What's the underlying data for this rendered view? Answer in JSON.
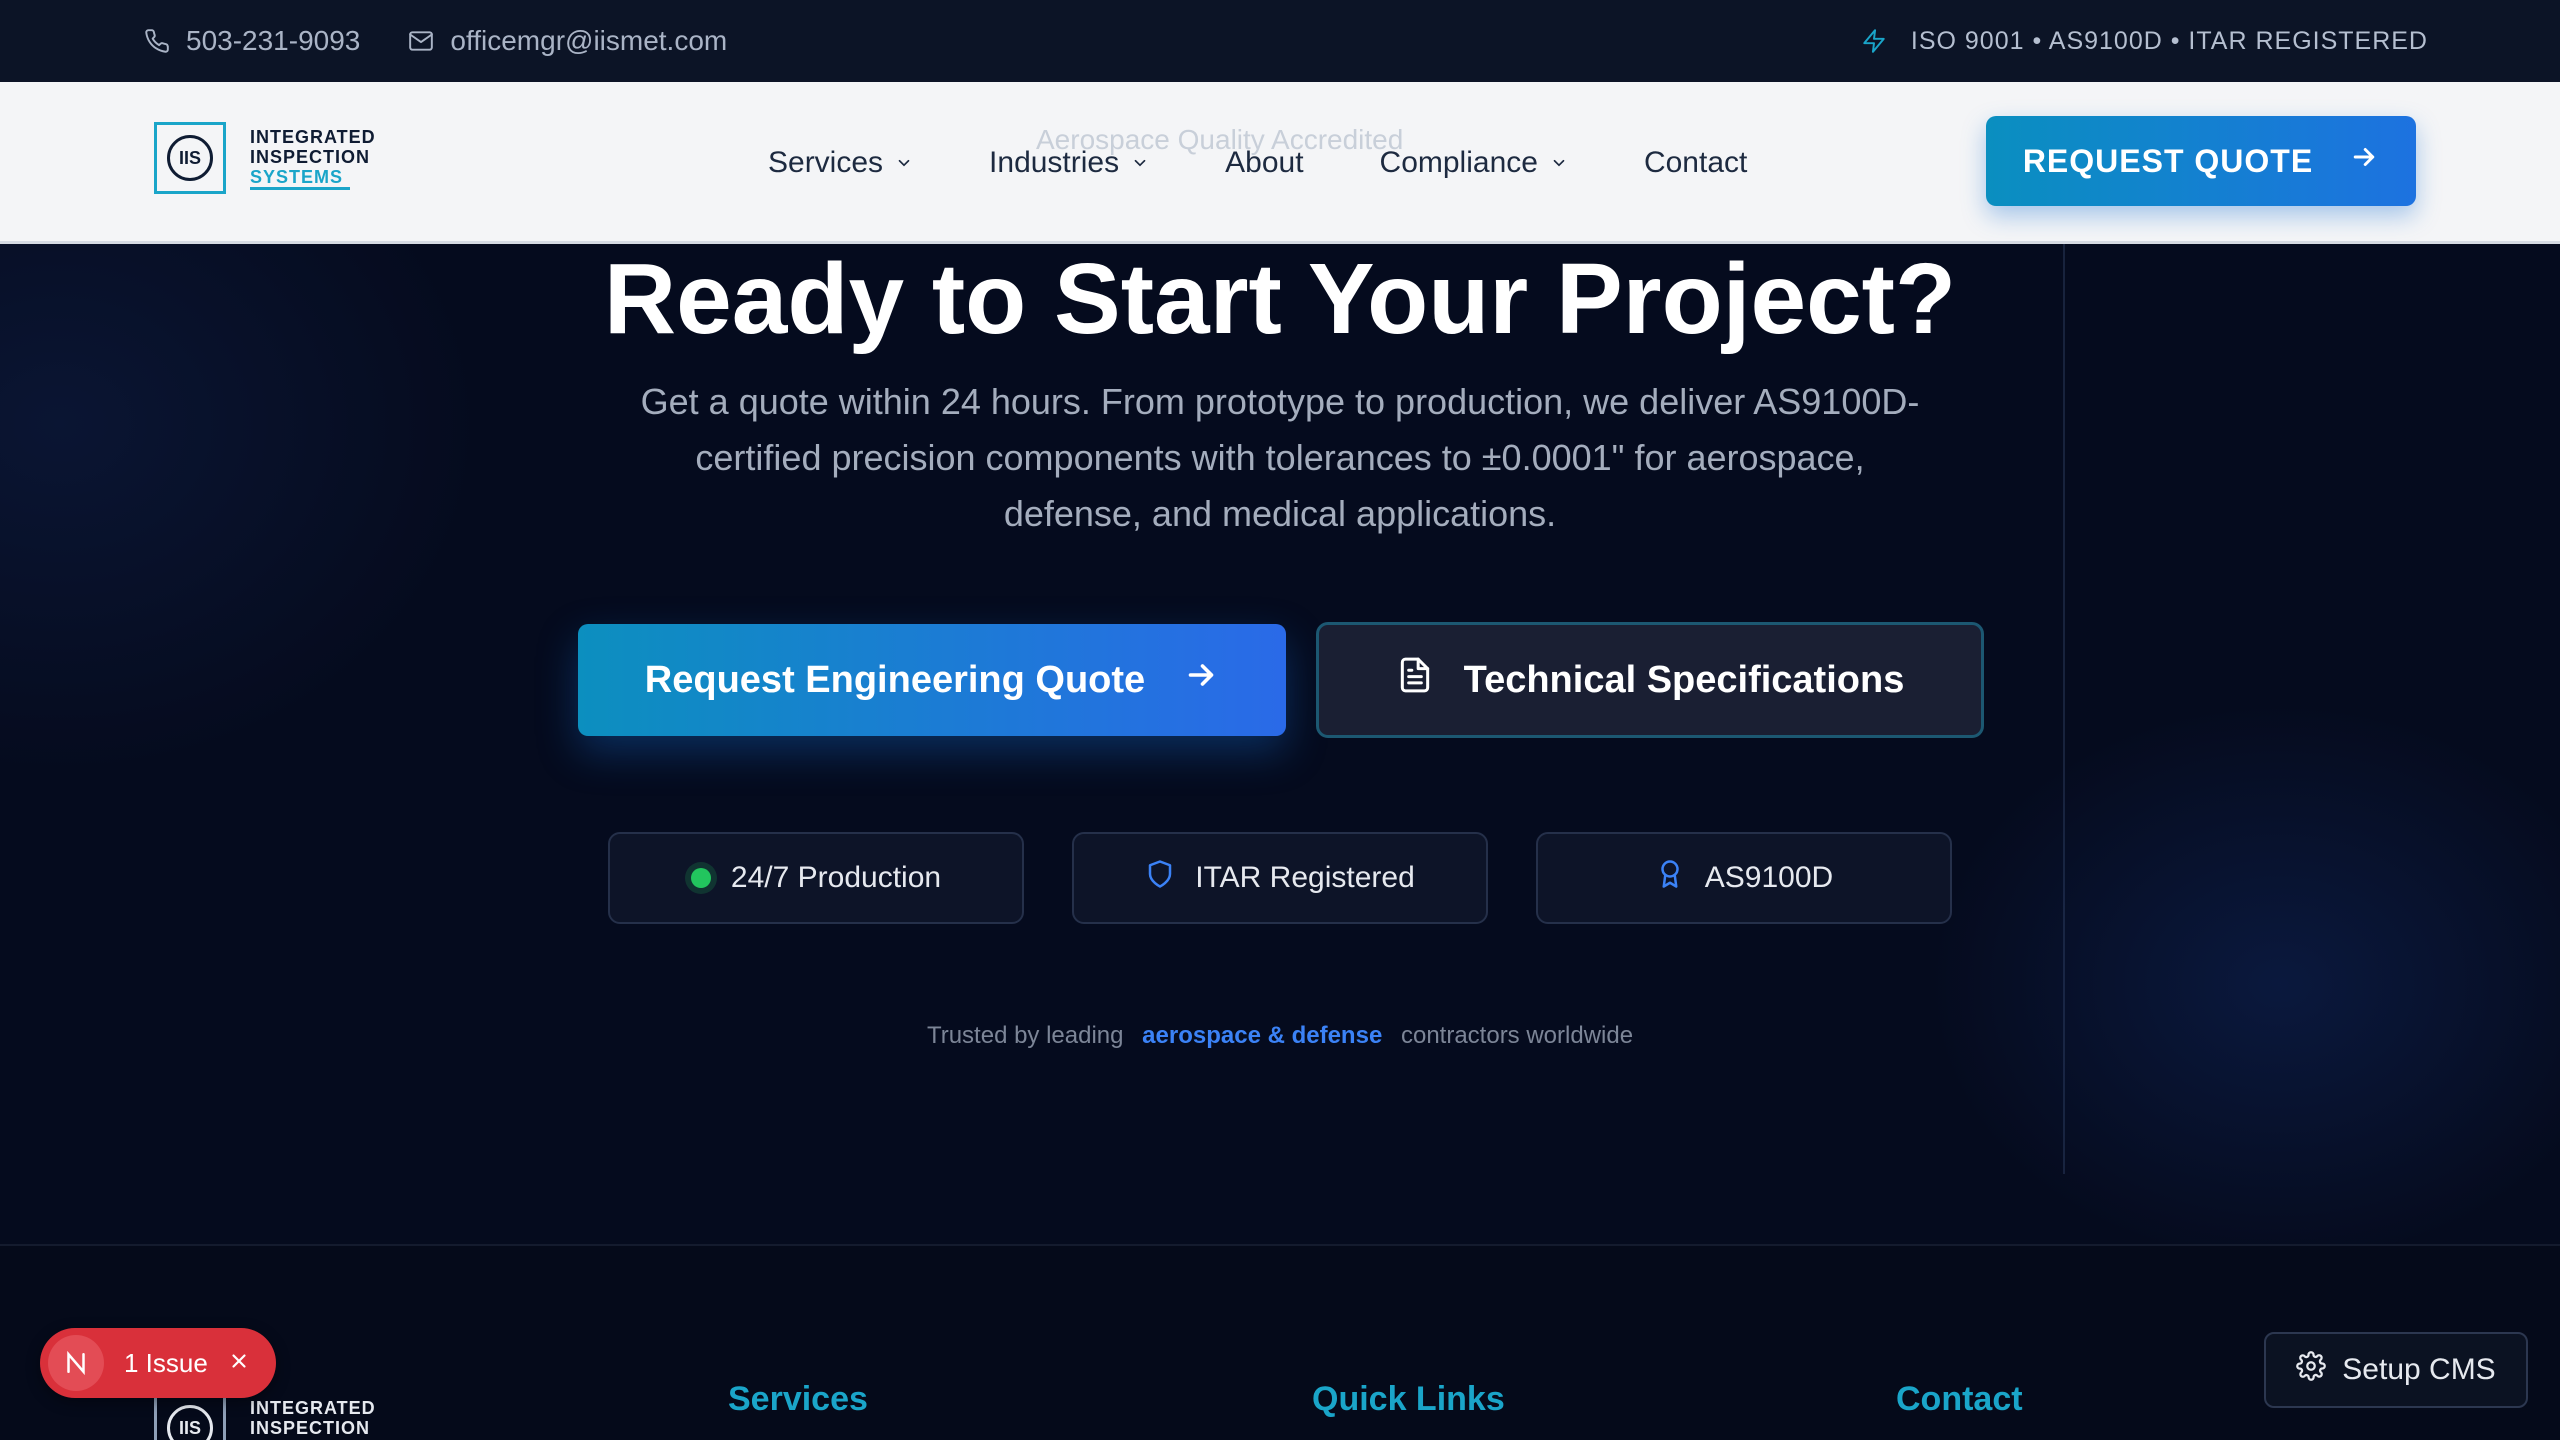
{
  "topbar": {
    "phone": "503-231-9093",
    "email": "officemgr@iismet.com",
    "certs": "ISO 9001 • AS9100D • ITAR REGISTERED",
    "icons": {
      "phone": "phone-icon",
      "email": "mail-icon",
      "certs": "lightning-icon"
    }
  },
  "logo": {
    "mark": "IIS",
    "line1": "INTEGRATED",
    "line2": "INSPECTION",
    "line3": "SYSTEMS"
  },
  "nav": {
    "items": [
      {
        "label": "Services",
        "dropdown": true
      },
      {
        "label": "Industries",
        "dropdown": true
      },
      {
        "label": "About",
        "dropdown": false
      },
      {
        "label": "Compliance",
        "dropdown": true
      },
      {
        "label": "Contact",
        "dropdown": false
      }
    ],
    "ghost_text": "Aerospace Quality Accredited",
    "cta": "REQUEST QUOTE"
  },
  "hero": {
    "title": "Ready to Start Your Project?",
    "subtitle": "Get a quote within 24 hours. From prototype to production, we deliver AS9100D-certified precision components with tolerances to ±0.0001\" for aerospace, defense, and medical applications.",
    "primary_button": "Request Engineering Quote",
    "secondary_button": "Technical Specifications",
    "badges": [
      {
        "label": "24/7 Production",
        "icon": "status-dot-icon"
      },
      {
        "label": "ITAR Registered",
        "icon": "shield-icon"
      },
      {
        "label": "AS9100D",
        "icon": "award-icon"
      }
    ],
    "trusted_prefix": "Trusted by leading",
    "trusted_highlight": "aerospace & defense",
    "trusted_suffix": "contractors worldwide"
  },
  "footer": {
    "headings": [
      "Services",
      "Quick Links",
      "Contact"
    ]
  },
  "overlays": {
    "issue_count": "1 Issue",
    "issue_badge": "N",
    "setup_cms": "Setup CMS"
  },
  "colors": {
    "accent": "#1aa5c9",
    "primary_blue": "#2a6ae8",
    "background": "#050b1e",
    "success": "#22c55e",
    "error": "#d9303a"
  }
}
